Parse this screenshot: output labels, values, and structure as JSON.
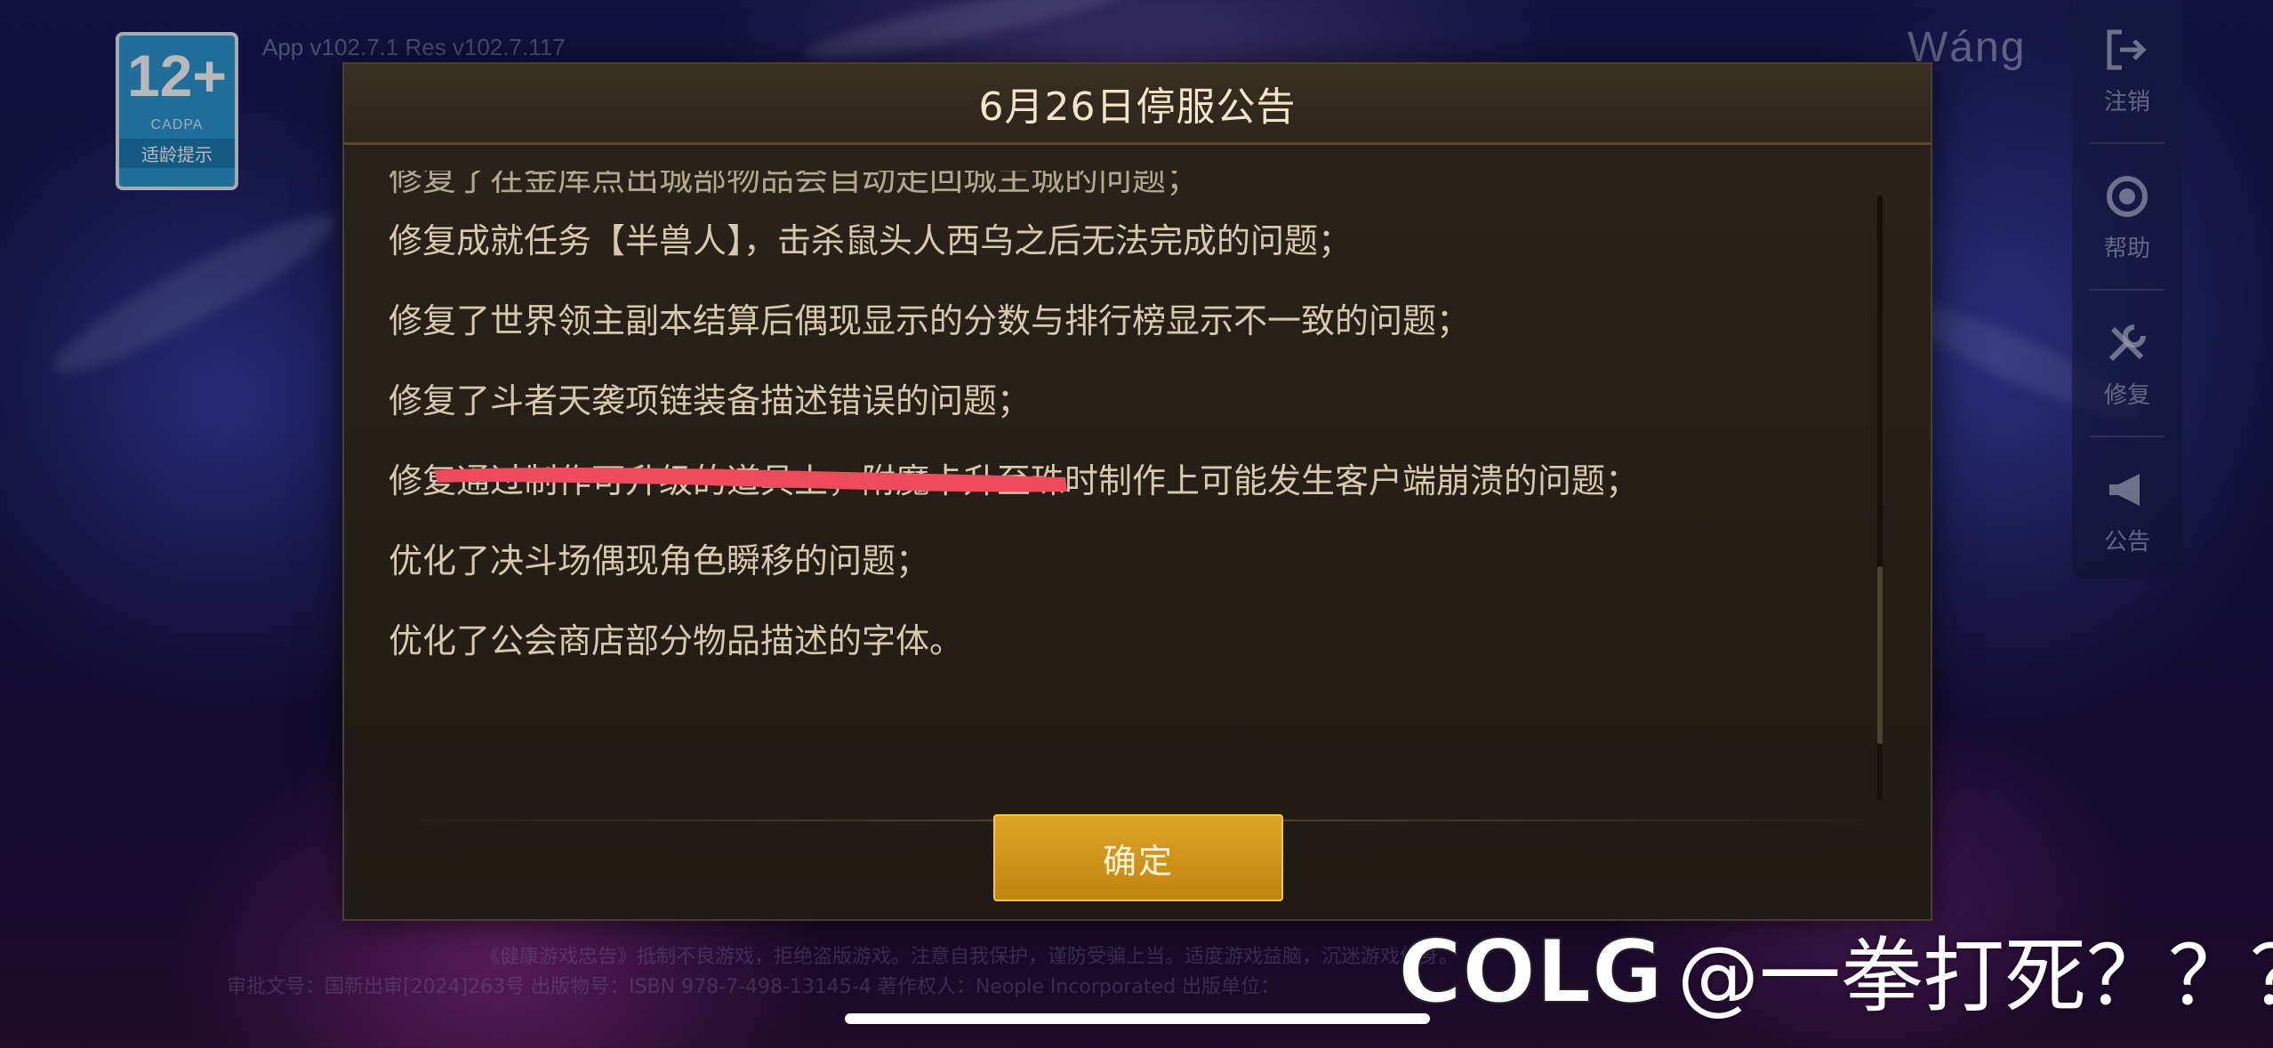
{
  "header": {
    "age_rating": "12+",
    "age_org": "CADPA",
    "age_tip": "适龄提示",
    "version": "App v102.7.1 Res v102.7.117",
    "username": "Wáng"
  },
  "sidebar": {
    "items": [
      {
        "icon": "logout-icon",
        "label": "注销"
      },
      {
        "icon": "help-icon",
        "label": "帮助"
      },
      {
        "icon": "repair-icon",
        "label": "修复"
      },
      {
        "icon": "megaphone-icon",
        "label": "公告"
      }
    ]
  },
  "dialog": {
    "title": "6月26日停服公告",
    "partial_line": "修复了在金库点出城部物品会自动走回城主城的问题；",
    "lines": [
      "修复成就任务【半兽人】，击杀鼠头人西乌之后无法完成的问题；",
      "修复了世界领主副本结算后偶现显示的分数与排行榜显示不一致的问题；",
      "修复了斗者天袭项链装备描述错误的问题；",
      "修复通过制作可升级的道具上，附魔卡升至珠时制作上可能发生客户端崩溃的问题；",
      "优化了决斗场偶现角色瞬移的问题；",
      "优化了公会商店部分物品描述的字体。"
    ],
    "confirm_label": "确定",
    "scroll_position": 0.82
  },
  "footer": {
    "line1": "《健康游戏忠告》抵制不良游戏，拒绝盗版游戏。注意自我保护，谨防受骗上当。适度游戏益脑，沉迷游戏伤身。",
    "line2": "审批文号：国新出审[2024]263号 出版物号：ISBN 978-7-498-13145-4 著作权人：Neople Incorporated 出版单位："
  },
  "watermark": {
    "logo_text": "COLG",
    "handle": "@一拳打死？？？"
  },
  "colors": {
    "dialog_bg": "#241e17",
    "text": "#d6c9ac",
    "title": "#f3e6c8",
    "button": "#d39a1c",
    "redact": "#ef4b5c"
  }
}
